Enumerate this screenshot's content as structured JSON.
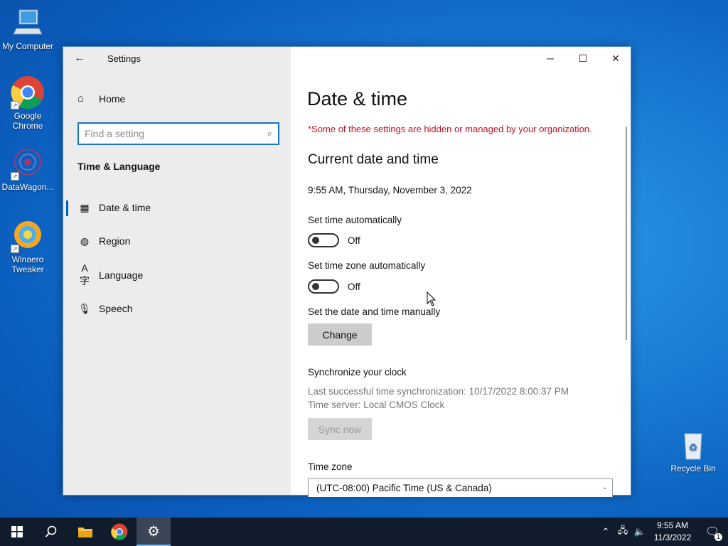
{
  "desktop": {
    "icons": [
      {
        "label": "My Computer",
        "icon": "computer-icon"
      },
      {
        "label": "Google Chrome",
        "icon": "chrome-icon"
      },
      {
        "label": "DataWagon...",
        "icon": "datawagon-icon"
      },
      {
        "label": "Winaero Tweaker",
        "icon": "winaero-icon"
      },
      {
        "label": "Recycle Bin",
        "icon": "recycle-bin-icon"
      }
    ]
  },
  "window": {
    "title": "Settings",
    "sidebar": {
      "home_label": "Home",
      "search_placeholder": "Find a setting",
      "section_title": "Time & Language",
      "items": [
        {
          "label": "Date & time",
          "icon": "calendar-clock-icon",
          "active": true
        },
        {
          "label": "Region",
          "icon": "globe-icon",
          "active": false
        },
        {
          "label": "Language",
          "icon": "language-icon",
          "active": false
        },
        {
          "label": "Speech",
          "icon": "microphone-icon",
          "active": false
        }
      ]
    },
    "content": {
      "page_title": "Date & time",
      "managed_note": "*Some of these settings are hidden or managed by your organization.",
      "current_heading": "Current date and time",
      "current_datetime": "9:55 AM, Thursday, November 3, 2022",
      "set_time_auto": {
        "label": "Set time automatically",
        "state": "Off"
      },
      "set_tz_auto": {
        "label": "Set time zone automatically",
        "state": "Off"
      },
      "manual_label": "Set the date and time manually",
      "change_button": "Change",
      "sync_heading": "Synchronize your clock",
      "sync_last": "Last successful time synchronization: 10/17/2022 8:00:37 PM",
      "sync_server": "Time server: Local CMOS Clock",
      "sync_button": "Sync now",
      "timezone_label": "Time zone",
      "timezone_value": "(UTC-08:00) Pacific Time (US & Canada)"
    }
  },
  "taskbar": {
    "clock_time": "9:55 AM",
    "clock_date": "11/3/2022",
    "notification_count": "1"
  },
  "colors": {
    "accent": "#0063b1",
    "warning": "#c50f1f",
    "taskbar": "#101c2c"
  }
}
